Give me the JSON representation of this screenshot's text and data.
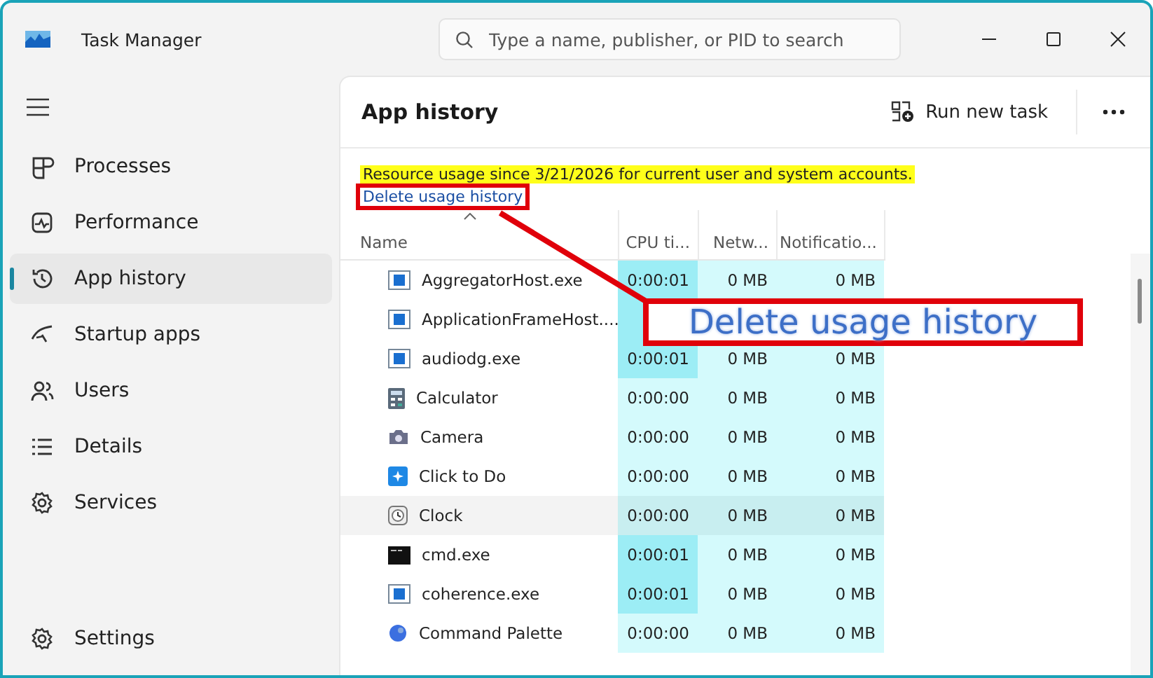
{
  "window": {
    "title": "Task Manager"
  },
  "search": {
    "placeholder": "Type a name, publisher, or PID to search"
  },
  "sidebar": {
    "items": [
      {
        "label": "Processes",
        "selected": false
      },
      {
        "label": "Performance",
        "selected": false
      },
      {
        "label": "App history",
        "selected": true
      },
      {
        "label": "Startup apps",
        "selected": false
      },
      {
        "label": "Users",
        "selected": false
      },
      {
        "label": "Details",
        "selected": false
      },
      {
        "label": "Services",
        "selected": false
      }
    ],
    "footer": {
      "label": "Settings",
      "selected": false
    }
  },
  "page": {
    "title": "App history",
    "run_task": "Run new task",
    "info": "Resource usage since 3/21/2026 for current user and system accounts.",
    "link": {
      "text": "Delete usage history",
      "annotated": true
    }
  },
  "table": {
    "columns": [
      "Name",
      "CPU ti...",
      "Netw...",
      "Notificatio..."
    ],
    "rows": [
      {
        "name": "AggregatorHost.exe",
        "kind": "app",
        "cpu": "0:00:01",
        "network": "0 MB",
        "notifications": "0 MB",
        "cpu_busy": true,
        "hovered": false
      },
      {
        "name": "ApplicationFrameHost....",
        "kind": "app",
        "cpu_busy": true,
        "hovered": false
      },
      {
        "name": "audiodg.exe",
        "kind": "app",
        "cpu": "0:00:01",
        "network": "0 MB",
        "notifications": "0 MB",
        "cpu_busy": true,
        "hovered": false
      },
      {
        "name": "Calculator",
        "kind": "calculator",
        "cpu": "0:00:00",
        "network": "0 MB",
        "notifications": "0 MB",
        "cpu_busy": false,
        "hovered": false
      },
      {
        "name": "Camera",
        "kind": "camera",
        "cpu": "0:00:00",
        "network": "0 MB",
        "notifications": "0 MB",
        "cpu_busy": false,
        "hovered": false
      },
      {
        "name": "Click to Do",
        "kind": "sparkle",
        "cpu": "0:00:00",
        "network": "0 MB",
        "notifications": "0 MB",
        "cpu_busy": false,
        "hovered": false
      },
      {
        "name": "Clock",
        "kind": "clock",
        "cpu": "0:00:00",
        "network": "0 MB",
        "notifications": "0 MB",
        "cpu_busy": false,
        "hovered": true
      },
      {
        "name": "cmd.exe",
        "kind": "terminal",
        "cpu": "0:00:01",
        "network": "0 MB",
        "notifications": "0 MB",
        "cpu_busy": true,
        "hovered": false
      },
      {
        "name": "coherence.exe",
        "kind": "app",
        "cpu": "0:00:01",
        "network": "0 MB",
        "notifications": "0 MB",
        "cpu_busy": true,
        "hovered": false
      },
      {
        "name": "Command Palette",
        "kind": "palette",
        "cpu": "0:00:00",
        "network": "0 MB",
        "notifications": "0 MB",
        "cpu_busy": false,
        "hovered": false
      }
    ]
  },
  "callout": {
    "text": "Delete usage history"
  }
}
